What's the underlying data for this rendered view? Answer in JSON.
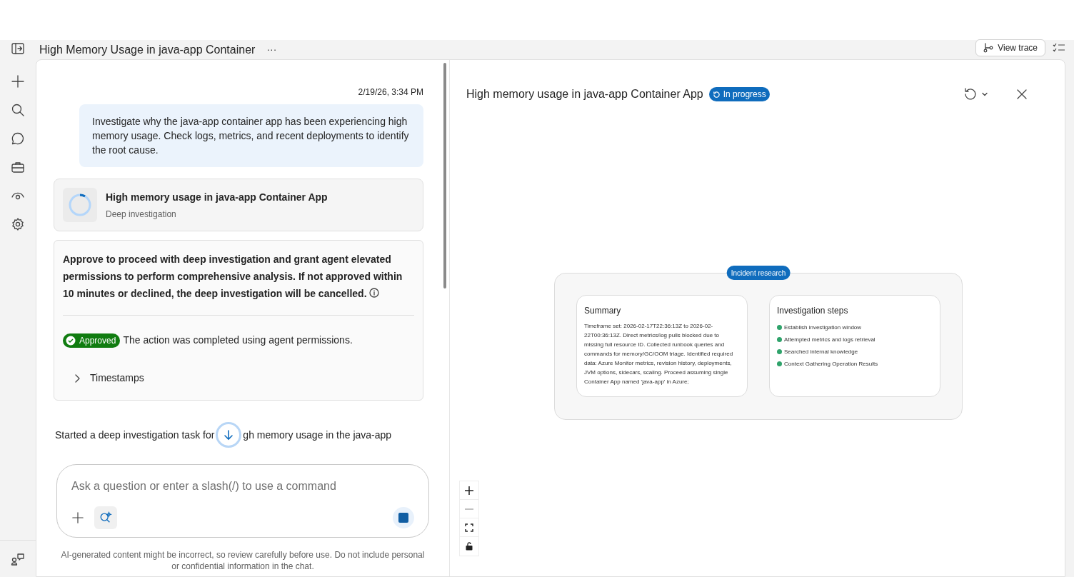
{
  "header": {
    "title": "High Memory Usage in java-app Container",
    "more": "···",
    "view_trace": "View trace"
  },
  "rail": {
    "items": [
      {
        "kind": "toggle"
      },
      {
        "kind": "plus"
      },
      {
        "kind": "search"
      },
      {
        "kind": "chat"
      },
      {
        "kind": "briefcase"
      },
      {
        "kind": "eye"
      },
      {
        "kind": "gear"
      }
    ],
    "bottom": {
      "kind": "people"
    }
  },
  "chat": {
    "timestamp": "2/19/26, 3:34 PM",
    "user_message": "Investigate why the java-app container app has been experiencing high memory usage. Check logs, metrics, and recent deployments to identify the root cause.",
    "task_card": {
      "title": "High memory usage in java-app Container App",
      "subtitle": "Deep investigation"
    },
    "approval": {
      "text": "Approve to proceed with deep investigation and grant agent elevated permissions to perform comprehensive analysis. If not approved within 10 minutes or declined, the deep investigation will be cancelled.",
      "status": "Approved",
      "status_text": "The action was completed using agent permissions.",
      "timestamps": "Timestamps",
      "expanded": false
    },
    "reply": [
      "Started a deep investigation task for",
      "gh memory usage in the java-app"
    ],
    "input": {
      "placeholder": "Ask a question or enter a slash(/) to use a command"
    },
    "disclaimer": "AI-generated content might be incorrect, so review carefully before use. Do not include personal or confidential information in the chat."
  },
  "panel": {
    "title": "High memory usage in java-app Container App",
    "status": "In progress",
    "group_label": "Incident research",
    "summary": {
      "title": "Summary",
      "text": "Timeframe set: 2026-02-17T22:36:13Z to 2026-02-22T00:36:13Z. Direct metrics/log pulls blocked due to missing full resource ID. Collected runbook queries and commands for memory/GC/OOM triage. Identified required data: Azure Monitor metrics, revision history, deployments, JVM options, sidecars, scaling. Proceed assuming single Container App named 'java-app' in Azure;"
    },
    "steps": {
      "title": "Investigation steps",
      "items": [
        {
          "label": "Establish investigation window",
          "done": true
        },
        {
          "label": "Attempted metrics and logs retrieval",
          "done": true
        },
        {
          "label": "Searched internal knowledge",
          "done": true
        },
        {
          "label": "Context Gathering Operation Results",
          "done": true
        }
      ]
    }
  }
}
